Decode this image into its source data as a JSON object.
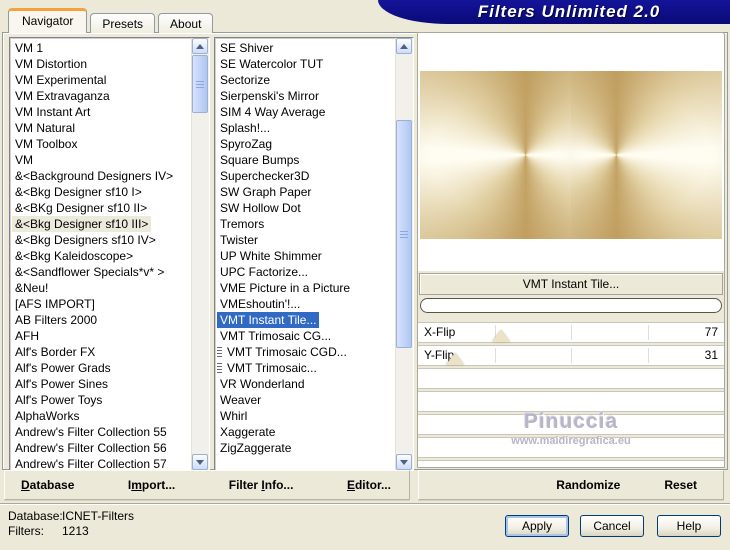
{
  "window": {
    "title": "Filters Unlimited 2.0"
  },
  "tabs": [
    {
      "label": "Navigator",
      "active": true
    },
    {
      "label": "Presets",
      "active": false
    },
    {
      "label": "About",
      "active": false
    }
  ],
  "category_list": {
    "selected_index": 11,
    "items": [
      "VM 1",
      "VM Distortion",
      "VM Experimental",
      "VM Extravaganza",
      "VM Instant Art",
      "VM Natural",
      "VM Toolbox",
      "VM",
      "&<Background Designers IV>",
      "&<Bkg Designer sf10 I>",
      "&<BKg Designer sf10 II>",
      "&<Bkg Designer sf10 III>",
      "&<Bkg Designers sf10 IV>",
      "&<Bkg Kaleidoscope>",
      "&<Sandflower Specials*v* >",
      "&Neu!",
      "[AFS IMPORT]",
      "AB Filters 2000",
      "AFH",
      "Alf's Border FX",
      "Alf's Power Grads",
      "Alf's Power Sines",
      "Alf's Power Toys",
      "AlphaWorks",
      "Andrew's Filter Collection 55",
      "Andrew's Filter Collection 56",
      "Andrew's Filter Collection 57"
    ]
  },
  "filter_list": {
    "selected_index": 17,
    "items": [
      "SE Shiver",
      "SE Watercolor TUT",
      "Sectorize",
      "Sierpenski's Mirror",
      "SIM 4 Way Average",
      "Splash!...",
      "SpyroZag",
      "Square Bumps",
      "Superchecker3D",
      "SW Graph Paper",
      "SW Hollow Dot",
      "Tremors",
      "Twister",
      "UP White Shimmer",
      "UPC Factorize...",
      "VME Picture in a Picture",
      "VMEshoutin'!...",
      "VMT Instant Tile...",
      "VMT Trimosaic CG...",
      {
        "label": "VMT Trimosaic CGD...",
        "icon": "grip-lines"
      },
      {
        "label": "VMT Trimosaic...",
        "icon": "grip-lines"
      },
      "VR Wonderland",
      "Weaver",
      "Whirl",
      "Xaggerate",
      "ZigZaggerate"
    ]
  },
  "controls": {
    "filter_label": "VMT Instant Tile...",
    "progress_percent": 0,
    "sliders": [
      {
        "name": "X-Flip",
        "value": 77,
        "percent": 27
      },
      {
        "name": "Y-Flip",
        "value": 31,
        "percent": 12
      }
    ],
    "watermark": {
      "line1": "Pinuccia",
      "line2": "www.maidiregrafica.eu"
    }
  },
  "toolbar": {
    "left": [
      {
        "pre": "",
        "mn": "D",
        "post": "atabase"
      },
      {
        "pre": "I",
        "mn": "m",
        "post": "port..."
      },
      {
        "pre": "Filter ",
        "mn": "I",
        "post": "nfo..."
      },
      {
        "pre": "",
        "mn": "E",
        "post": "ditor..."
      }
    ],
    "right": [
      "Randomize",
      "Reset"
    ]
  },
  "status": {
    "database_label": "Database:",
    "database_value": "ICNET-Filters",
    "filters_label": "Filters:",
    "filters_value": "1213"
  },
  "footer_buttons": [
    "Apply",
    "Cancel",
    "Help"
  ],
  "colors": {
    "background": "#ece9d8",
    "title_navy": "#0a0a78",
    "selection_blue": "#316ac5",
    "active_tab_orange": "#f0a33c"
  }
}
